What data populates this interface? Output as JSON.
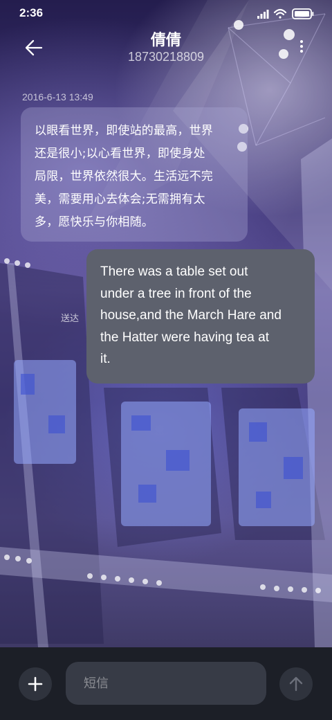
{
  "status_bar": {
    "time": "2:36",
    "icons": [
      "signal-icon",
      "wifi-icon",
      "battery-icon"
    ]
  },
  "header": {
    "contact_name": "倩倩",
    "phone_number": "18730218809",
    "icons": [
      "back-arrow-icon",
      "more-vertical-icon"
    ]
  },
  "conversation": {
    "timestamp": "2016-6-13 13:49",
    "received_message": {
      "lines": [
        "以眼看世界，即使站的最高，世界",
        "还是很小;以心看世界，即使身处",
        "局限，世界依然很大。生活远不完",
        "美，需要用心去体会;无需拥有太",
        "多，愿快乐与你相随。"
      ]
    },
    "sent_message": {
      "lines": [
        "There was a table set out",
        "under a tree in front of the",
        "house,and the March Hare and",
        "the Hatter were having tea at",
        "it."
      ],
      "status": "送达"
    }
  },
  "composer": {
    "placeholder": "短信",
    "icons": [
      "plus-icon",
      "send-arrow-up-icon"
    ]
  },
  "colors": {
    "sent_bubble": "#5d616d",
    "composer_background": "#1c1f27",
    "control_background": "#2f333d",
    "input_background": "#373b46"
  }
}
